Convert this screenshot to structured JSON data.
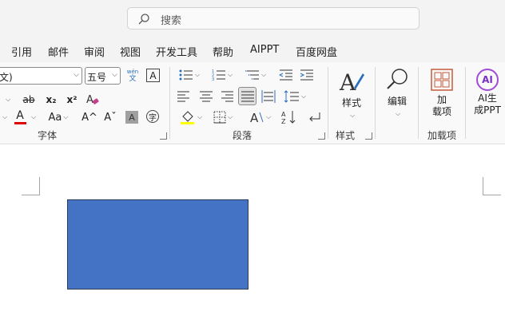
{
  "search": {
    "placeholder": "搜索"
  },
  "menu": [
    "引用",
    "邮件",
    "审阅",
    "视图",
    "开发工具",
    "帮助",
    "AIPPT",
    "百度网盘"
  ],
  "font": {
    "name_value": "文)",
    "size_value": "五号",
    "pinyin_top": "wén",
    "pinyin_bottom": "文",
    "border_char": "A",
    "strike": "ab",
    "sub": "x₂",
    "sup": "x²",
    "font_color_letter": "A",
    "case_label": "Aa",
    "grow": "A^",
    "shrink": "Aˇ",
    "shade_char": "A",
    "enclose_char": "字",
    "group_label": "字体"
  },
  "paragraph": {
    "group_label": "段落"
  },
  "styles": {
    "label": "样式",
    "group_label": "样式"
  },
  "editing": {
    "label": "编辑"
  },
  "addins": {
    "label_line1": "加",
    "label_line2": "载项",
    "group_label": "加载项"
  },
  "aippt": {
    "label_line1": "AI生",
    "label_line2": "成PPT",
    "icon_text": "AI"
  },
  "colors": {
    "accent": "#4472c4",
    "font_color_bar": "#e00000",
    "fill_bar": "#ffff00"
  }
}
